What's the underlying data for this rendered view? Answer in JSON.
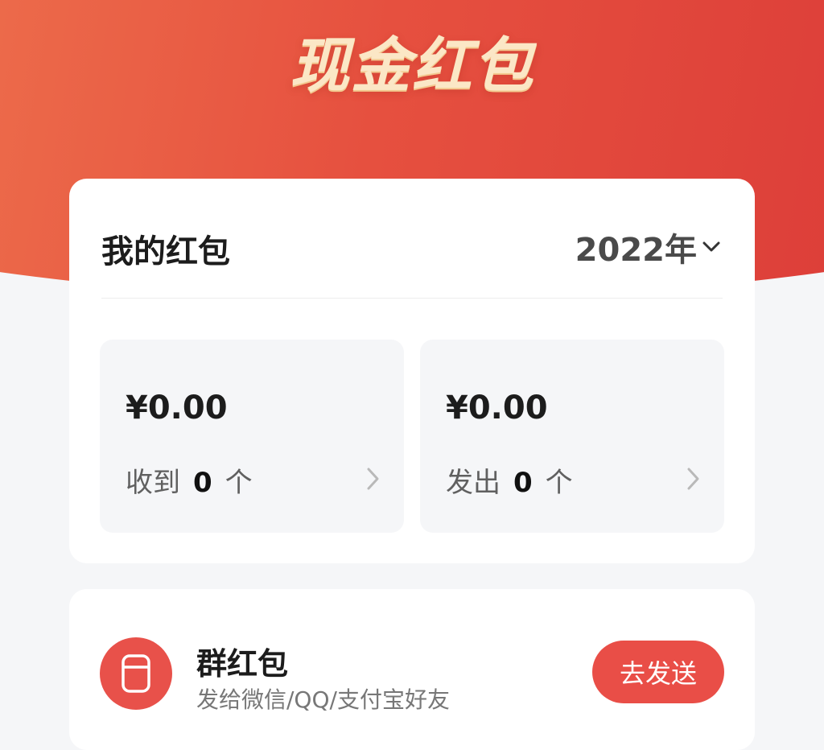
{
  "header": {
    "title": "现金红包"
  },
  "summary": {
    "title": "我的红包",
    "year": "2022年",
    "received": {
      "amount": "¥0.00",
      "label": "收到",
      "count": "0",
      "unit": "个"
    },
    "sent": {
      "amount": "¥0.00",
      "label": "发出",
      "count": "0",
      "unit": "个"
    }
  },
  "group_packet": {
    "title": "群红包",
    "subtitle": "发给微信/QQ/支付宝好友",
    "button_label": "去发送",
    "icon": "cup-icon"
  },
  "colors": {
    "primary": "#e94e47",
    "hero_start": "#ec6a4a",
    "hero_end": "#dd3f39",
    "title_gold": "#fbe7c6"
  }
}
